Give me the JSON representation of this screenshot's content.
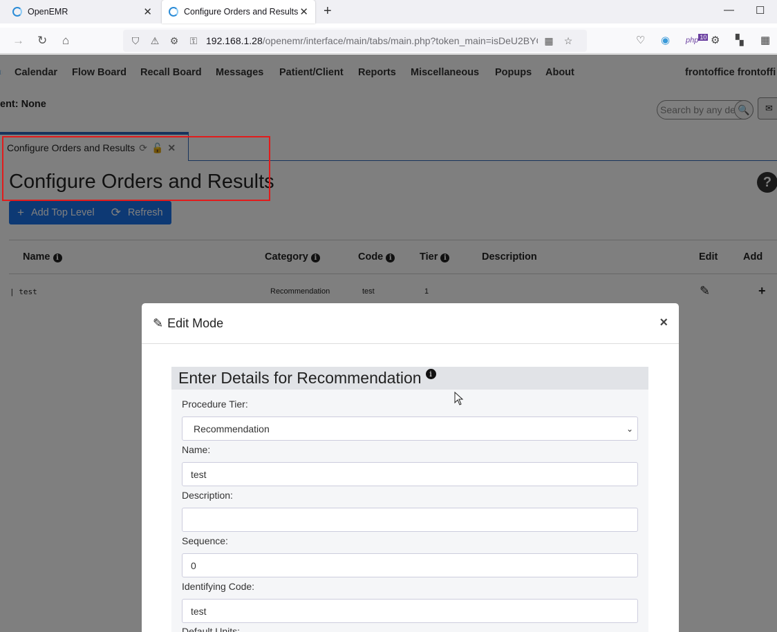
{
  "browser": {
    "tabs": [
      {
        "title": "OpenEMR"
      },
      {
        "title": "Configure Orders and Results"
      }
    ],
    "url_host": "192.168.1.28",
    "url_path": "/openemr/interface/main/tabs/main.php?token_main=isDeU2BYCL",
    "ext_badge": "10"
  },
  "menu": {
    "items": [
      "Calendar",
      "Flow Board",
      "Recall Board",
      "Messages",
      "Patient/Client",
      "Reports",
      "Miscellaneous",
      "Popups",
      "About"
    ],
    "user": "frontoffice frontoffi"
  },
  "patient_label": "ent: None",
  "search": {
    "placeholder": "Search by any de"
  },
  "app_tab": {
    "title": "Configure Orders and Results"
  },
  "page": {
    "title": "Configure Orders and Results",
    "buttons": {
      "add_top_level": "Add Top Level",
      "refresh": "Refresh"
    }
  },
  "table": {
    "headers": {
      "name": "Name",
      "category": "Category",
      "code": "Code",
      "tier": "Tier",
      "description": "Description",
      "edit": "Edit",
      "add": "Add"
    },
    "rows": [
      {
        "name": "| test",
        "category": "Recommendation",
        "code": "test",
        "tier": "1",
        "description": ""
      }
    ]
  },
  "modal": {
    "title": "Edit Mode",
    "section_title": "Enter Details for Recommendation",
    "fields": {
      "procedure_tier": {
        "label": "Procedure Tier:",
        "value": "Recommendation"
      },
      "name": {
        "label": "Name:",
        "value": "test"
      },
      "description": {
        "label": "Description:",
        "value": ""
      },
      "sequence": {
        "label": "Sequence:",
        "value": "0"
      },
      "identifying_code": {
        "label": "Identifying Code:",
        "value": "test"
      },
      "default_units": {
        "label": "Default Units:"
      }
    }
  },
  "colors": {
    "accent": "#1a73e8",
    "highlight": "#e21b1b",
    "tab_border": "#2f68b8"
  }
}
